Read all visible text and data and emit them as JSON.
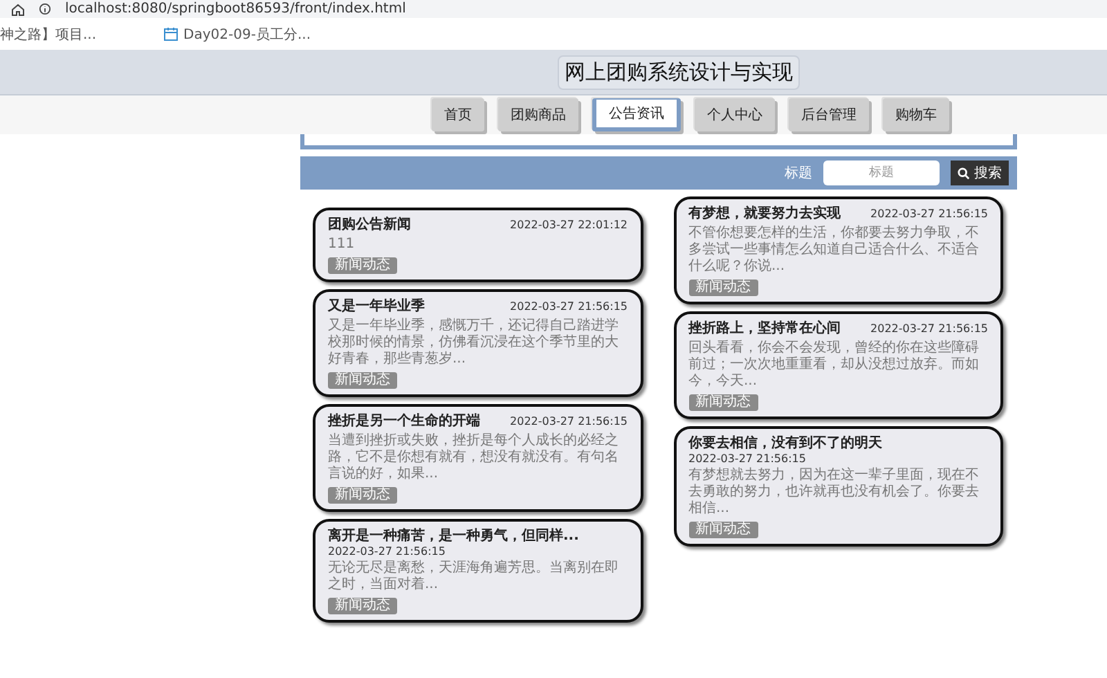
{
  "browser": {
    "url": "localhost:8080/springboot86593/front/index.html",
    "bookmarks": [
      "神之路】项目...",
      "Day02-09-员工分..."
    ]
  },
  "site_title": "网上团购系统设计与实现",
  "nav": [
    {
      "label": "首页",
      "selected": false
    },
    {
      "label": "团购商品",
      "selected": false
    },
    {
      "label": "公告资讯",
      "selected": true
    },
    {
      "label": "个人中心",
      "selected": false
    },
    {
      "label": "后台管理",
      "selected": false
    },
    {
      "label": "购物车",
      "selected": false
    }
  ],
  "search": {
    "label": "标题",
    "placeholder": "标题",
    "button": "搜索"
  },
  "news_columns": [
    [
      {
        "title": "团购公告新闻",
        "date": "2022-03-27 22:01:12",
        "text": "111",
        "tag": "新闻动态"
      },
      {
        "title": "又是一年毕业季",
        "date": "2022-03-27 21:56:15",
        "text": "又是一年毕业季，感慨万千，还记得自己踏进学校那时候的情景，仿佛看沉浸在这个季节里的大好青春，那些青葱岁...",
        "tag": "新闻动态"
      },
      {
        "title": "挫折是另一个生命的开端",
        "date": "2022-03-27 21:56:15",
        "text": "当遭到挫折或失败，挫折是每个人成长的必经之路，它不是你想有就有，想没有就没有。有句名言说的好，如果...",
        "tag": "新闻动态"
      },
      {
        "title": "离开是一种痛苦，是一种勇气，但同样...",
        "date": "2022-03-27 21:56:15",
        "text": "无论无尽是离愁，天涯海角遍芳思。当离别在即之时，当面对着...",
        "tag": "新闻动态"
      }
    ],
    [
      {
        "title": "有梦想，就要努力去实现",
        "date": "2022-03-27 21:56:15",
        "text": "不管你想要怎样的生活，你都要去努力争取，不多尝试一些事情怎么知道自己适合什么、不适合什么呢？你说...",
        "tag": "新闻动态"
      },
      {
        "title": "挫折路上，坚持常在心间",
        "date": "2022-03-27 21:56:15",
        "text": "回头看看，你会不会发现，曾经的你在这些障碍前过；一次次地重重看，却从没想过放弃。而如今，今天...",
        "tag": "新闻动态"
      },
      {
        "title": "你要去相信，没有到不了的明天",
        "date": "2022-03-27 21:56:15",
        "text": "有梦想就去努力，因为在这一辈子里面，现在不去勇敢的努力，也许就再也没有机会了。你要去相信...",
        "tag": "新闻动态"
      }
    ]
  ]
}
